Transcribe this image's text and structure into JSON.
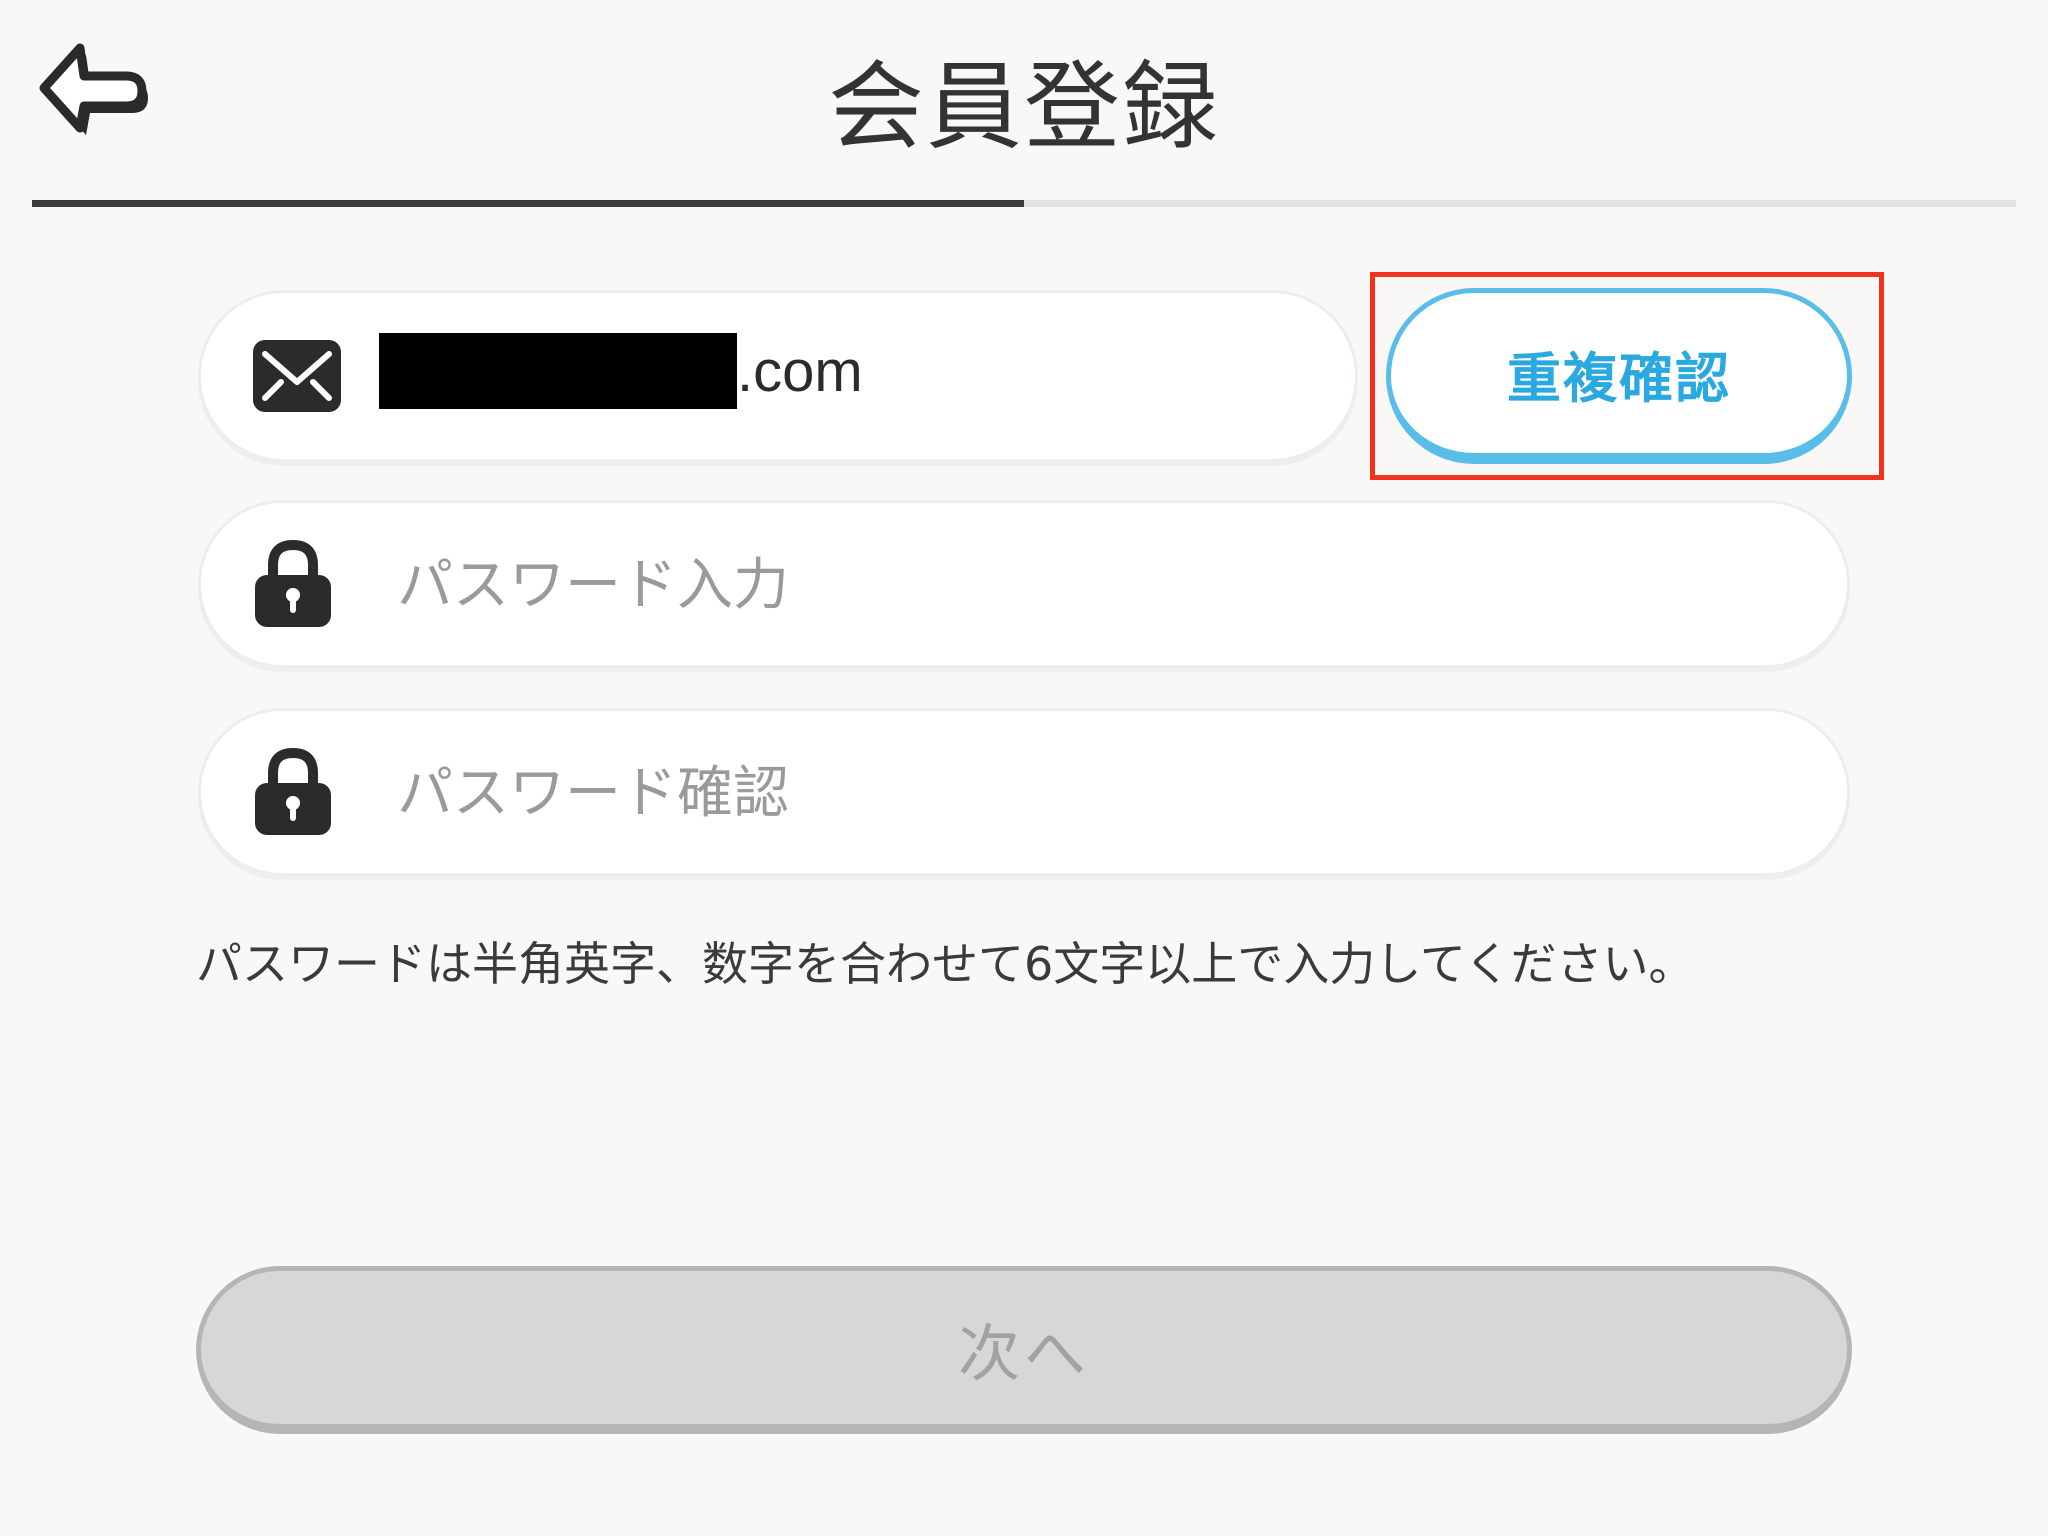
{
  "header": {
    "back_icon": "back-arrow-icon",
    "title": "会員登録",
    "progress": 0.5
  },
  "email": {
    "icon": "envelope-icon",
    "value_suffix": ".com"
  },
  "duplicate_check": {
    "label": "重複確認",
    "highlight_color": "#f2321c",
    "accent_color": "#2aa8e0"
  },
  "password": {
    "icon": "lock-icon",
    "placeholder": "パスワード入力"
  },
  "password_confirm": {
    "icon": "lock-icon",
    "placeholder": "パスワード確認"
  },
  "hint": "パスワードは半角英字、数字を合わせて6文字以上で入力してください。",
  "next_button": {
    "label": "次へ"
  }
}
